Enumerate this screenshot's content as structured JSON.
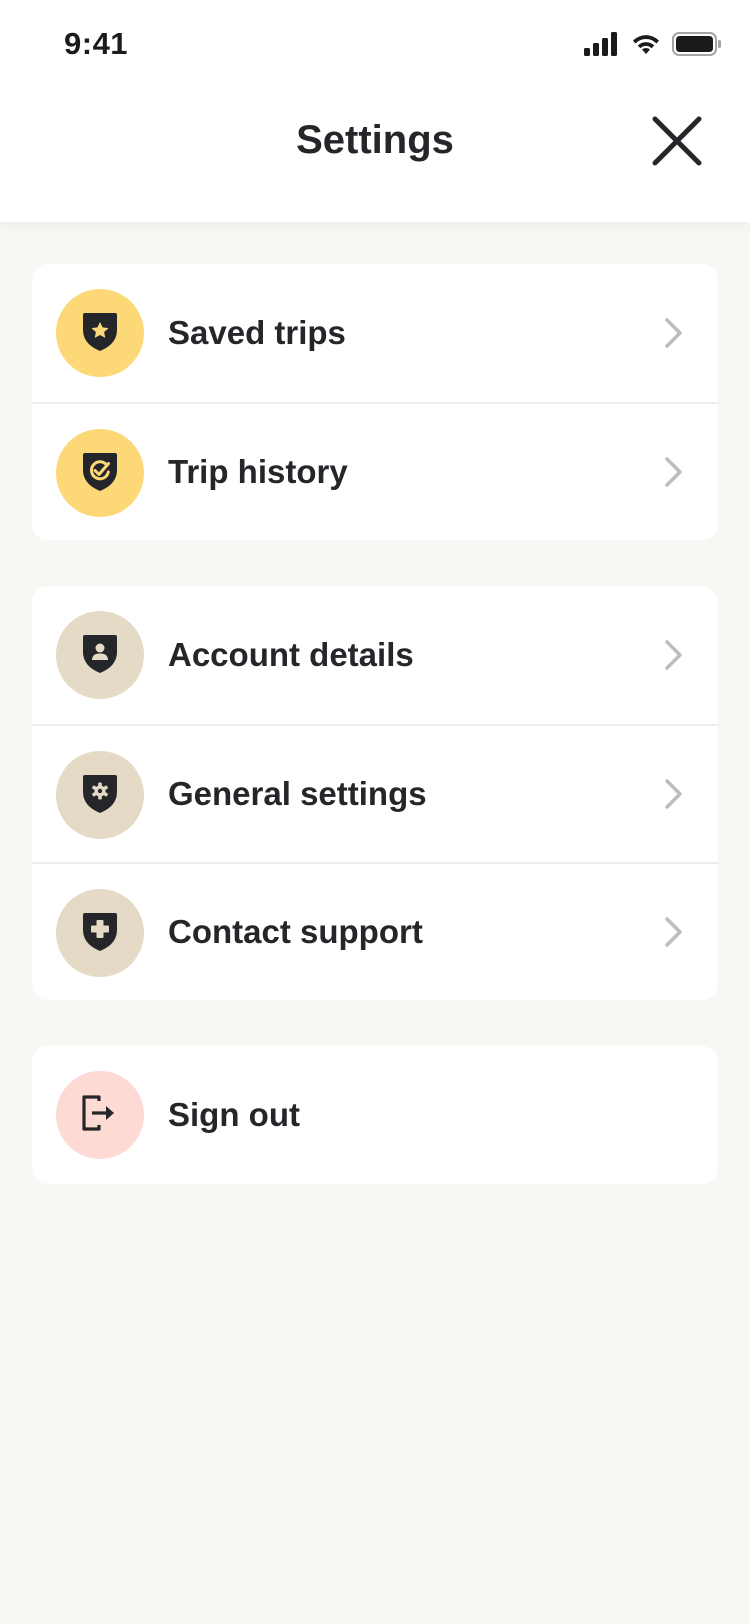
{
  "status_bar": {
    "time": "9:41",
    "signal_icon": "cellular-signal-icon",
    "wifi_icon": "wifi-icon",
    "battery_icon": "battery-icon"
  },
  "header": {
    "title": "Settings",
    "close_icon": "close-icon"
  },
  "colors": {
    "background": "#f8f7f4",
    "yellow_icon_bg": "#fdd877",
    "beige_icon_bg": "#e4dac6",
    "pink_icon_bg": "#fddad3",
    "icon_fg": "#24262a",
    "chevron": "#bdbdbd"
  },
  "groups": [
    {
      "items": [
        {
          "label": "Saved trips",
          "icon": "shield-star-icon"
        },
        {
          "label": "Trip history",
          "icon": "shield-check-icon"
        }
      ]
    },
    {
      "items": [
        {
          "label": "Account details",
          "icon": "shield-user-icon"
        },
        {
          "label": "General settings",
          "icon": "shield-gear-icon"
        },
        {
          "label": "Contact support",
          "icon": "shield-plus-icon"
        }
      ]
    },
    {
      "items": [
        {
          "label": "Sign out",
          "icon": "sign-out-icon"
        }
      ]
    }
  ]
}
